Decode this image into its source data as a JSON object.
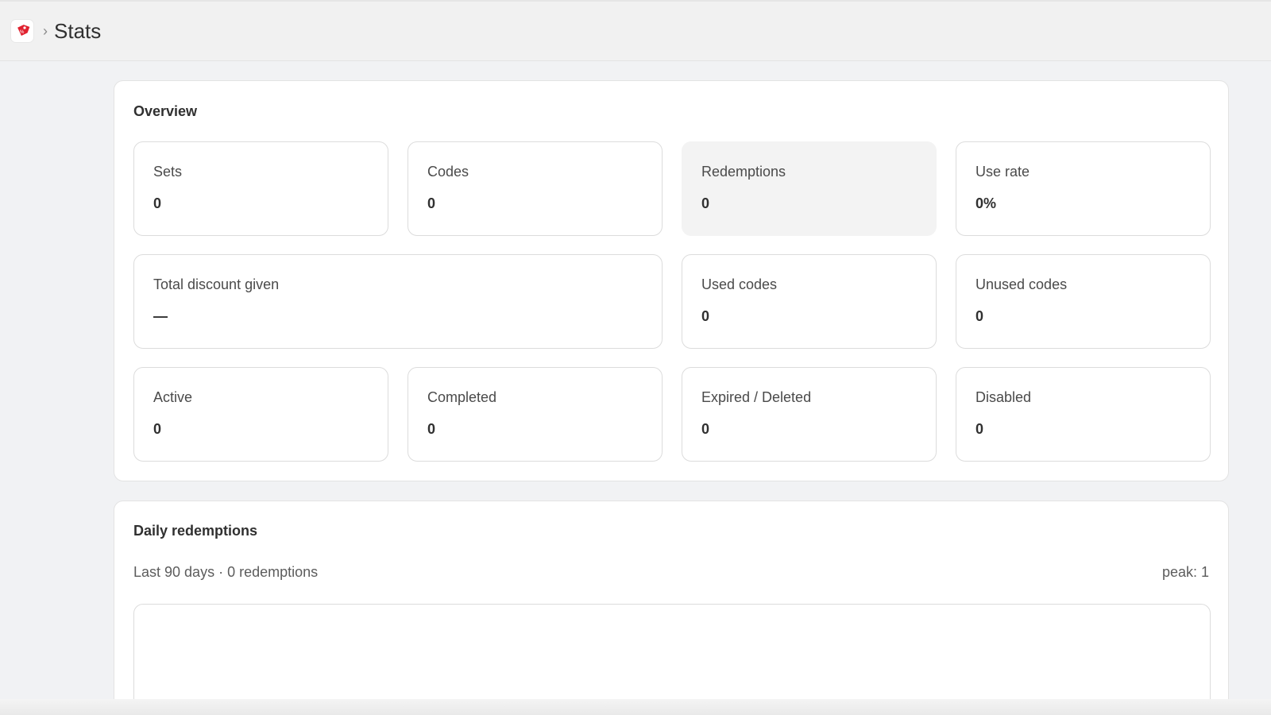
{
  "header": {
    "breadcrumb_separator": "›",
    "title": "Stats"
  },
  "overview": {
    "title": "Overview",
    "stats": [
      {
        "label": "Sets",
        "value": "0"
      },
      {
        "label": "Codes",
        "value": "0"
      },
      {
        "label": "Redemptions",
        "value": "0"
      },
      {
        "label": "Use rate",
        "value": "0%"
      },
      {
        "label": "Total discount given",
        "value": "—"
      },
      {
        "label": "Used codes",
        "value": "0"
      },
      {
        "label": "Unused codes",
        "value": "0"
      },
      {
        "label": "Active",
        "value": "0"
      },
      {
        "label": "Completed",
        "value": "0"
      },
      {
        "label": "Expired / Deleted",
        "value": "0"
      },
      {
        "label": "Disabled",
        "value": "0"
      }
    ]
  },
  "daily": {
    "title": "Daily redemptions",
    "subtitle": "Last 90 days · 0 redemptions",
    "peak": "peak: 1"
  },
  "colors": {
    "app_icon": "#e0212f",
    "page_background": "#f1f2f4",
    "highlight_card": "#f3f3f3"
  },
  "icons": {
    "app": "discount-tag-icon"
  }
}
